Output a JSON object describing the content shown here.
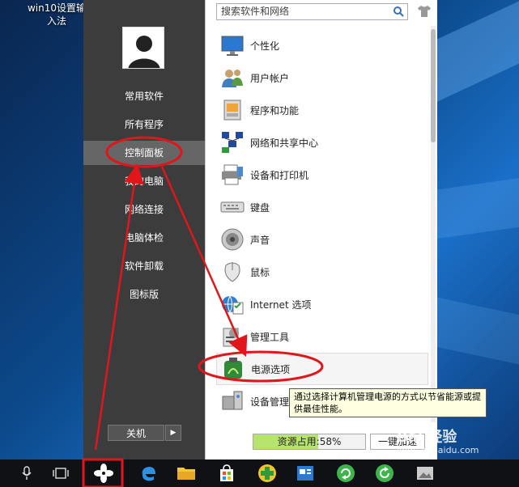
{
  "desktop": {
    "icon_label": "win10设置输入法"
  },
  "start": {
    "left_items": [
      "常用软件",
      "所有程序",
      "控制面板",
      "我的电脑",
      "网络连接",
      "电脑体检",
      "软件卸载",
      "图标版"
    ],
    "active_index": 2,
    "shutdown_label": "关机"
  },
  "search": {
    "placeholder": "搜索软件和网络"
  },
  "right_items": [
    {
      "label": "个性化",
      "icon": "monitor-icon"
    },
    {
      "label": "用户帐户",
      "icon": "users-icon"
    },
    {
      "label": "程序和功能",
      "icon": "programs-icon"
    },
    {
      "label": "网络和共享中心",
      "icon": "network-icon"
    },
    {
      "label": "设备和打印机",
      "icon": "printer-icon"
    },
    {
      "label": "键盘",
      "icon": "keyboard-icon"
    },
    {
      "label": "声音",
      "icon": "speaker-icon"
    },
    {
      "label": "鼠标",
      "icon": "mouse-icon"
    },
    {
      "label": "Internet 选项",
      "icon": "internet-options-icon"
    },
    {
      "label": "管理工具",
      "icon": "admin-tools-icon"
    },
    {
      "label": "电源选项",
      "icon": "power-icon"
    },
    {
      "label": "设备管理",
      "icon": "device-manager-icon"
    }
  ],
  "highlighted_index": 10,
  "tooltip": "通过选择计算机管理电源的方式以节省能源或提供最佳性能。",
  "usage": {
    "label": "资源占用:",
    "value": "58%",
    "fraction": 0.58
  },
  "speed_button": "一键加速",
  "watermark": {
    "brand": "Bai 经验",
    "url": "jingyan.baidu.com"
  },
  "taskbar_icons": [
    "mic-icon",
    "task-view-icon",
    "start-fan-icon",
    "edge-icon",
    "folder-icon",
    "store-icon",
    "plus-app-icon",
    "app-icon",
    "refresh-app-icon",
    "refresh-app-icon-2",
    "image-app-icon"
  ],
  "colors": {
    "annotation_red": "#e0161b",
    "left_panel": "#3c3c3c",
    "usage_fill": "#b7e36f"
  }
}
